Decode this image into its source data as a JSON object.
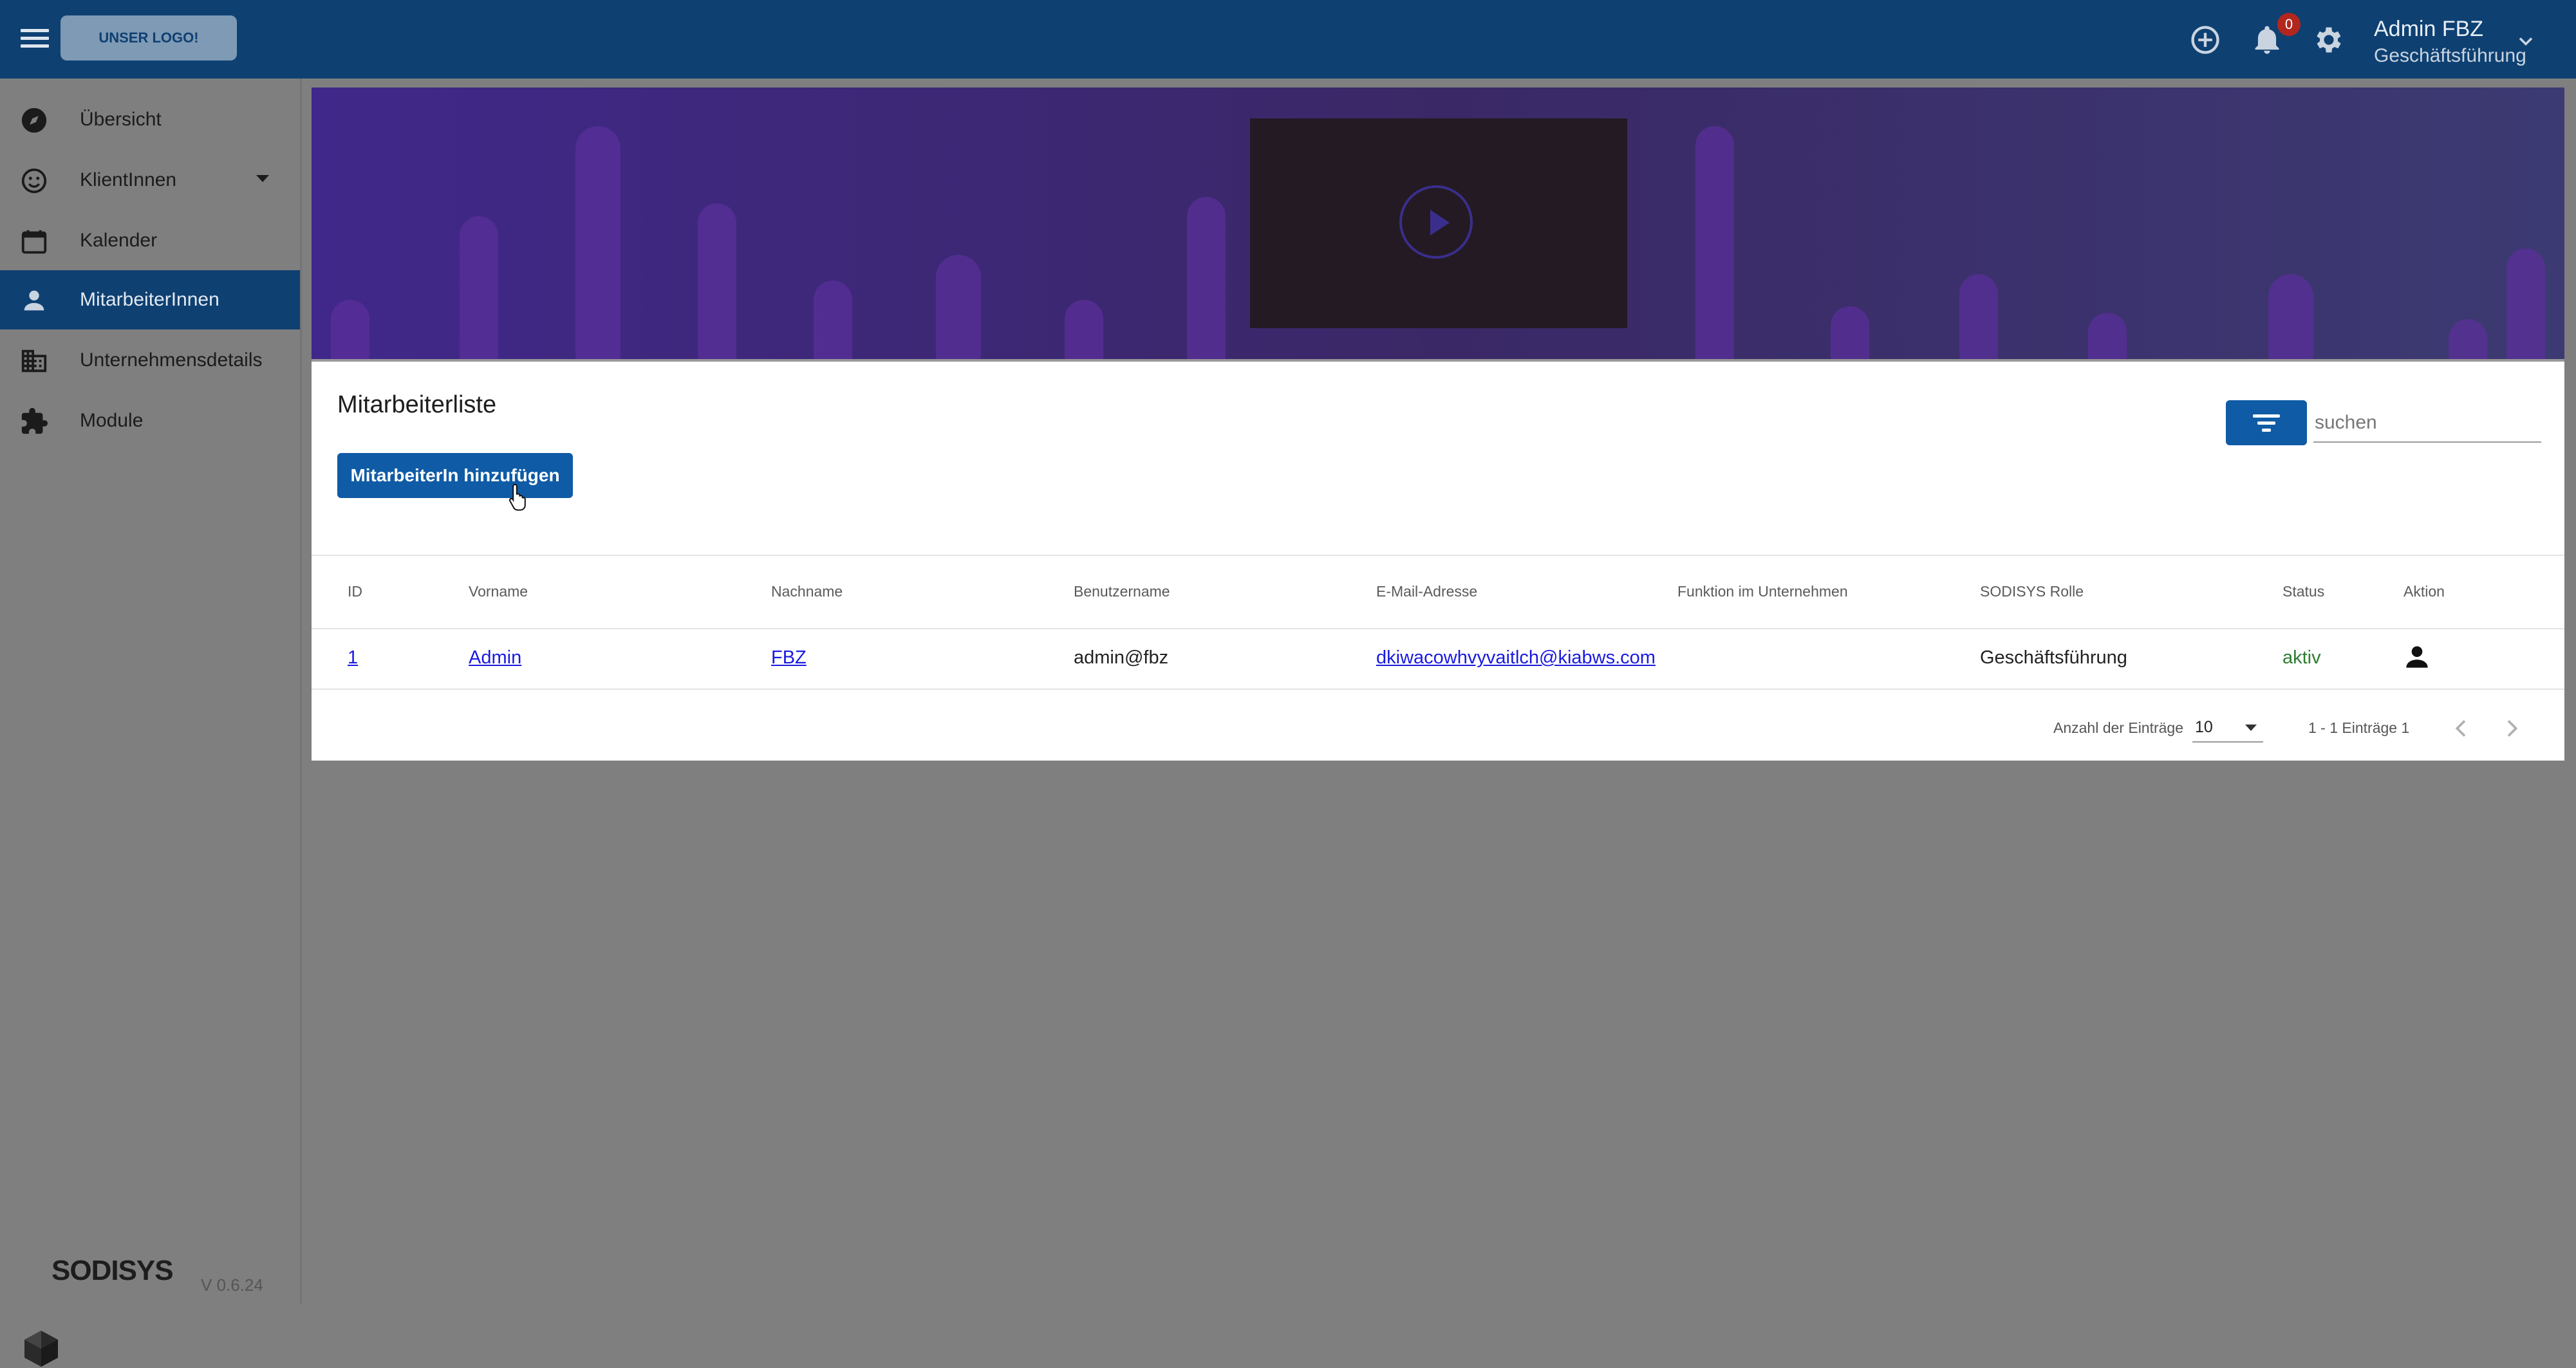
{
  "header": {
    "logo_label": "UNSER LOGO!",
    "notification_count": "0",
    "user_name": "Admin FBZ",
    "user_role": "Geschäftsführung"
  },
  "sidebar": {
    "items": [
      {
        "label": "Übersicht",
        "icon": "compass-icon"
      },
      {
        "label": "KlientInnen",
        "icon": "smiley-icon"
      },
      {
        "label": "Kalender",
        "icon": "calendar-icon"
      },
      {
        "label": "MitarbeiterInnen",
        "icon": "person-icon",
        "active": true
      },
      {
        "label": "Unternehmensdetails",
        "icon": "building-icon"
      },
      {
        "label": "Module",
        "icon": "puzzle-icon"
      }
    ],
    "brand": "SODISYS",
    "version": "V 0.6.24"
  },
  "main": {
    "title": "Mitarbeiterliste",
    "add_button": "MitarbeiterIn hinzufügen",
    "search_placeholder": "suchen",
    "table": {
      "columns": [
        "ID",
        "Vorname",
        "Nachname",
        "Benutzername",
        "E-Mail-Adresse",
        "Funktion im Unternehmen",
        "SODISYS Rolle",
        "Status",
        "Aktion"
      ],
      "rows": [
        {
          "id": "1",
          "vorname": "Admin",
          "nachname": "FBZ",
          "benutzername": "admin@fbz",
          "email": "dkiwacowhvyvaitlch@kiabws.com",
          "funktion": "",
          "rolle": "Geschäftsführung",
          "status": "aktiv"
        }
      ]
    },
    "pagination": {
      "label": "Anzahl der Einträge",
      "page_size": "10",
      "range": "1 - 1 Einträge 1"
    }
  },
  "colors": {
    "topbar": "#0e4072",
    "primary_button": "#0f5ba6",
    "status_active": "#2e7d32",
    "link": "#1a1ae0"
  }
}
